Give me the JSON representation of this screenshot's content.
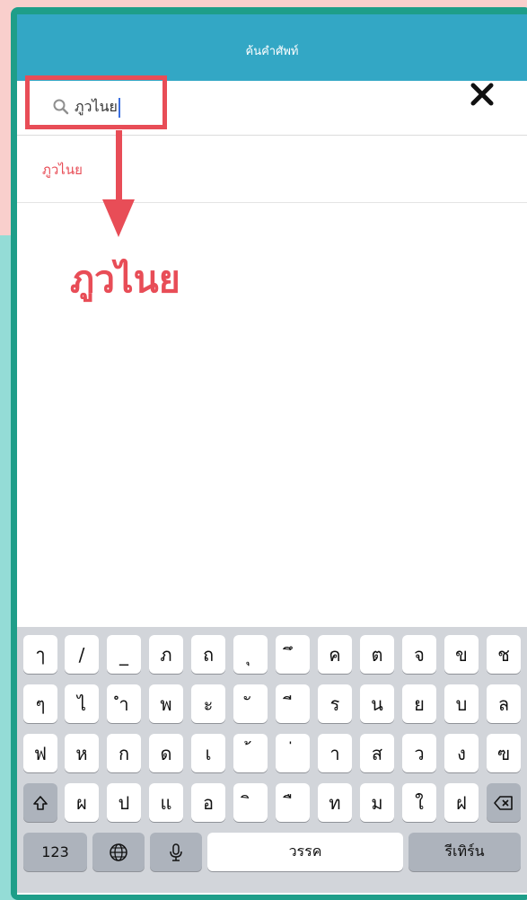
{
  "header": {
    "title": "ค้นคำศัพท์"
  },
  "search": {
    "value": "ภูวไนย",
    "icon": "search-icon",
    "clear_icon": "close-icon"
  },
  "results": [
    {
      "label": "ภูวไนย"
    }
  ],
  "annotation": {
    "text": "ภูวไนย",
    "color": "#e84d57"
  },
  "colors": {
    "nav_bar": "#33a7c5",
    "frame": "#1e9e89",
    "accent": "#e84d57",
    "background_top": "#f9cfcc",
    "background_bottom": "#94dcd6"
  },
  "keyboard": {
    "row1": [
      "ๅ",
      "/",
      "_",
      "ภ",
      "ถ",
      "ุ",
      "ึ",
      "ค",
      "ต",
      "จ",
      "ข",
      "ช"
    ],
    "row2": [
      "ๆ",
      "ไ",
      "ำ",
      "พ",
      "ะ",
      "ั",
      "ี",
      "ร",
      "น",
      "ย",
      "บ",
      "ล"
    ],
    "row3": [
      "ฟ",
      "ห",
      "ก",
      "ด",
      "เ",
      "้",
      "่",
      "า",
      "ส",
      "ว",
      "ง",
      "ฃ"
    ],
    "row4": [
      "ผ",
      "ป",
      "แ",
      "อ",
      "ิ",
      "ื",
      "ท",
      "ม",
      "ใ",
      "ฝ"
    ],
    "numbers_label": "123",
    "space_label": "วรรค",
    "return_label": "รีเทิร์น"
  }
}
